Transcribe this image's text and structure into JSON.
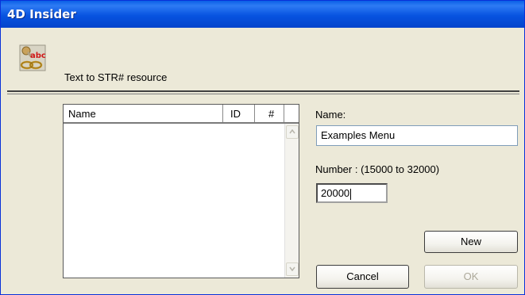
{
  "window": {
    "title": "4D Insider"
  },
  "header": {
    "icon": "text-to-resource-icon",
    "label": "Text to STR# resource"
  },
  "list": {
    "columns": [
      "Name",
      "ID",
      "#"
    ],
    "rows": []
  },
  "form": {
    "name_label": "Name:",
    "name_value": "Examples Menu",
    "number_label": "Number :  (15000 to 32000)",
    "number_value": "20000"
  },
  "buttons": {
    "new": "New",
    "cancel": "Cancel",
    "ok": "OK"
  },
  "colors": {
    "titlebar": "#0753E0",
    "dialog_bg": "#ECE9D8",
    "disabled_text": "#ACA899"
  }
}
